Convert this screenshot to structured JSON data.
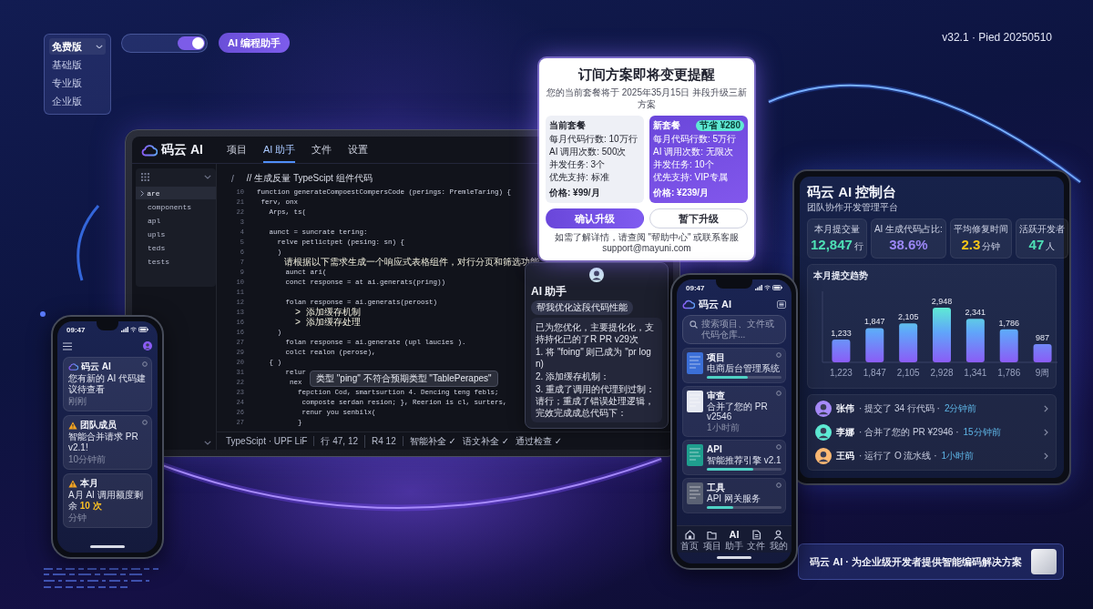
{
  "plan_menu": {
    "items": [
      {
        "label": "免费版",
        "selected": true
      },
      {
        "label": "基础版",
        "selected": false
      },
      {
        "label": "专业版",
        "selected": false
      },
      {
        "label": "企业版",
        "selected": false
      }
    ]
  },
  "toggle": {
    "on": true
  },
  "badge": "AI 编程助手",
  "version": "v32.1 · Pied 20250510",
  "laptop": {
    "brand": "码云 AI",
    "tabs": [
      {
        "label": "项目",
        "selected": false
      },
      {
        "label": "AI 助手",
        "selected": true
      },
      {
        "label": "文件",
        "selected": false
      },
      {
        "label": "设置",
        "selected": false
      }
    ],
    "sidebar": [
      {
        "label": "are",
        "selected": true
      },
      {
        "label": "components",
        "selected": false
      },
      {
        "label": "apl",
        "selected": false
      },
      {
        "label": "upls",
        "selected": false
      },
      {
        "label": "teds",
        "selected": false
      },
      {
        "label": "tests",
        "selected": false
      }
    ],
    "editor": {
      "path": "/",
      "comment": "// 生成反量 TypeScipt 组件代码",
      "lines": [
        {
          "number": "10",
          "kind": "code",
          "text": "function generateCompoestCompersCode (perings: PremleTaring) {"
        },
        {
          "number": "21",
          "kind": "code",
          "text": " ferv, onx"
        },
        {
          "number": "22",
          "kind": "code",
          "text": "   Arps, ts("
        },
        {
          "number": "3"
        },
        {
          "number": "4",
          "kind": "code",
          "text": "   aunct = suncrate tering:"
        },
        {
          "number": "5",
          "kind": "code",
          "text": "     relve petlictpet (pesing: sn) {"
        },
        {
          "number": "6",
          "kind": "code",
          "text": "     )"
        },
        {
          "number": "7",
          "kind": "text",
          "text": "     请根据以下需求生成一个响应式表格组件，对行分页和筛选功能"
        },
        {
          "number": "9",
          "kind": "code",
          "text": "       aunct ari("
        },
        {
          "number": "10",
          "kind": "code",
          "text": "       conct response = at ai.generats(pring))"
        },
        {
          "number": "11"
        },
        {
          "number": "12",
          "kind": "code",
          "text": "       folan response = ai.generats(peroost)"
        },
        {
          "number": "13",
          "kind": "text",
          "text": "       > 添加缓存机制"
        },
        {
          "number": "16",
          "kind": "text",
          "text": "       > 添加缓存处理"
        },
        {
          "number": "16",
          "kind": "code",
          "text": "     )"
        },
        {
          "number": "27",
          "kind": "code",
          "text": "       folan response = ai.generate (upl laucies )."
        },
        {
          "number": "29",
          "kind": "code",
          "text": "       colct realon (perose),"
        },
        {
          "number": "20",
          "kind": "code",
          "text": "   { )"
        },
        {
          "number": "31",
          "kind": "code",
          "text": "       relur",
          "tooltip": "类型 \"ping\" 不符合预期类型 \"TablePerapes\""
        },
        {
          "number": "22",
          "kind": "code",
          "text": "        nex"
        },
        {
          "number": "23",
          "kind": "code",
          "text": "          fepction Cod, smartsurtion 4. Dencing teng febls;"
        },
        {
          "number": "24",
          "kind": "code",
          "text": "           composte serdan resion; }, Reerion is cl, surters,"
        },
        {
          "number": "26",
          "kind": "code",
          "text": "           renur you senbilx("
        },
        {
          "number": "27",
          "kind": "code",
          "text": "          }"
        }
      ]
    },
    "status_bar": {
      "items": [
        "TypeScipt · UPF LiF",
        "行 47, 12",
        "R4 12"
      ],
      "checks": [
        "智能补全 ✓",
        "语文补全 ✓",
        "通过检查 ✓"
      ]
    }
  },
  "dialog": {
    "title": "订间方案即将变更提醒",
    "subtitle": "您的当前套餐将于 2025年35月15日 并段升级三新方案",
    "plans": [
      {
        "kind": "current",
        "title": "当前套餐",
        "features": [
          "每月代码行数: 10万行",
          "AI 调用次数: 500次",
          "并发任务: 3个",
          "优先支持: 标准"
        ],
        "price": "价格: ¥99/月"
      },
      {
        "kind": "new",
        "title": "新套餐",
        "badge": "节省 ¥280",
        "features": [
          "每月代码行数: 5万行",
          "AI 调用次数: 无限次",
          "并发任务: 10个",
          "优先支持: VIP专属"
        ],
        "price": "价格: ¥239/月"
      }
    ],
    "buttons": [
      {
        "kind": "primary",
        "label": "确认升级"
      },
      {
        "kind": "secondary",
        "label": "暂下升级"
      }
    ],
    "footer": "如需了解详情，请查阅 \"帮助中心\" 或联系客服 support@mayuni.com"
  },
  "assistant": {
    "title": "AI 助手",
    "prompt": "帮我优化这段代码性能",
    "reply": "已为您优化，主要提化化，支持持化已的了R PR v29次",
    "steps": [
      "1. 将 \"foing\" 则已成为 \"pr log n)",
      "2. 添加缓存机制：",
      "3. 重成了调用的代理到过制：请行；重成了错误处理逻辑，完效完成成总代码下："
    ]
  },
  "left_phone": {
    "time": "09:47",
    "notifications": [
      {
        "kind": "app",
        "title": "码云 AI",
        "body": "您有新的 AI 代码建议待查看",
        "time": "刚刚",
        "dismissible": true
      },
      {
        "kind": "warning",
        "title": "团队成员",
        "body": "智能合并请求 PR v2.1!",
        "time": "10分钟前",
        "dismissible": true
      },
      {
        "kind": "warning",
        "title": "本月",
        "body": "A月 AI 调用额度剩余 **10 次**",
        "time": "分钟",
        "dismissible": false
      }
    ]
  },
  "right_phone": {
    "time": "09:47",
    "app_name": "码云 AI",
    "search": {
      "placeholder": "搜索项目、文件或代码仓库..."
    },
    "projects": [
      {
        "title": "项目",
        "subtitle": "电商后台管理系统",
        "level": 0.55,
        "color": "#3b6fd8"
      },
      {
        "title": "审查",
        "subtitle": "合并了您的 PR v2546",
        "time": "1小时前",
        "color": "#e6e9f2"
      },
      {
        "title": "API",
        "subtitle": "智能推荐引擎 v2.1",
        "level": 0.62,
        "color": "#1f9e8e"
      },
      {
        "title": "工具",
        "subtitle": "API 网关服务",
        "level": 0.35,
        "color": "#5b6274"
      }
    ],
    "tabs": [
      {
        "label": "首页"
      },
      {
        "label": "项目"
      },
      {
        "label": "助手",
        "glyph": "AI"
      },
      {
        "label": "文件"
      },
      {
        "label": "我的"
      }
    ]
  },
  "tablet": {
    "title": "码云 AI 控制台",
    "subtitle": "团队协作开发管理平台",
    "stats": [
      {
        "label": "本月提交量",
        "value": "12,847",
        "unit": "行",
        "color": "#4ee0b5"
      },
      {
        "label": "AI 生成代码占比:",
        "value": "38.6%",
        "color": "#9b87f5"
      },
      {
        "label": "平均修复时间",
        "value": "2.3",
        "unit": "分钟",
        "color": "#f5c518"
      },
      {
        "label": "活跃开发者",
        "value": "47",
        "unit": "人",
        "color": "#4ee0b5"
      }
    ],
    "chart": {
      "chart_data": {
        "type": "bar",
        "title": "本月提交趋势",
        "categories": [
          "1,223",
          "1,847",
          "2,105",
          "2,928",
          "1,341",
          "1,786",
          "9周"
        ],
        "values": [
          1233,
          1847,
          2105,
          2948,
          2341,
          1786,
          987
        ],
        "value_labels": [
          "1,233",
          "1,847",
          "2,105",
          "2,948",
          "2,341",
          "1,786",
          "987"
        ]
      }
    },
    "activity": [
      {
        "name": "张伟",
        "action": "· 提交了 34 行代码 ·",
        "time": "2分钟前",
        "color": "#a78bfa"
      },
      {
        "name": "李娜",
        "action": "· 合并了您的 PR ¥2946 ·",
        "time": "15分钟前",
        "color": "#5eead4"
      },
      {
        "name": "王码",
        "action": "· 运行了 O 流水线 ·",
        "time": "1小时前",
        "color": "#fdba74"
      }
    ]
  },
  "banner": {
    "text": "码云 AI · 为企业级开发者提供智能编码解决方案"
  }
}
